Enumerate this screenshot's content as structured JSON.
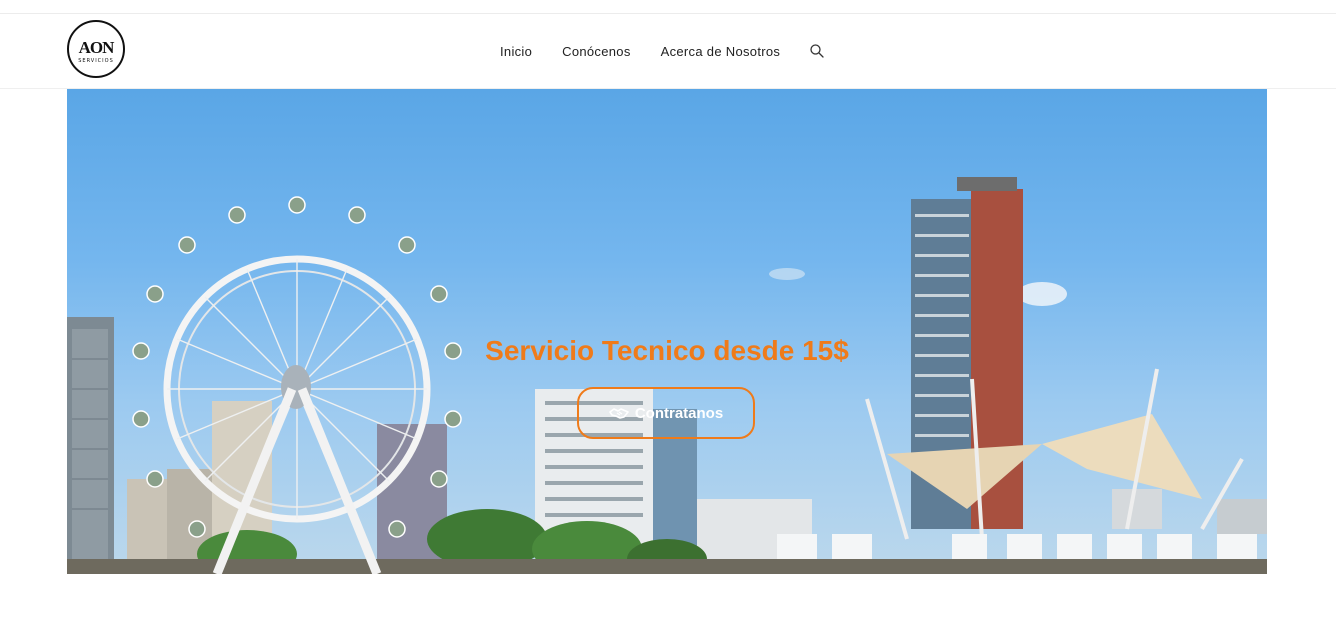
{
  "brand": {
    "logo_text": "AON",
    "logo_subtext": "SERVICIOS"
  },
  "nav": {
    "items": [
      {
        "label": "Inicio"
      },
      {
        "label": "Conócenos"
      },
      {
        "label": "Acerca de Nosotros"
      }
    ],
    "search_icon": "search-icon"
  },
  "hero": {
    "title": "Servicio Tecnico desde 15$",
    "cta_label": "Contratanos",
    "cta_icon": "handshake-icon"
  },
  "colors": {
    "accent": "#ef7b1a",
    "sky": "#74b6ee",
    "text": "#222222"
  }
}
